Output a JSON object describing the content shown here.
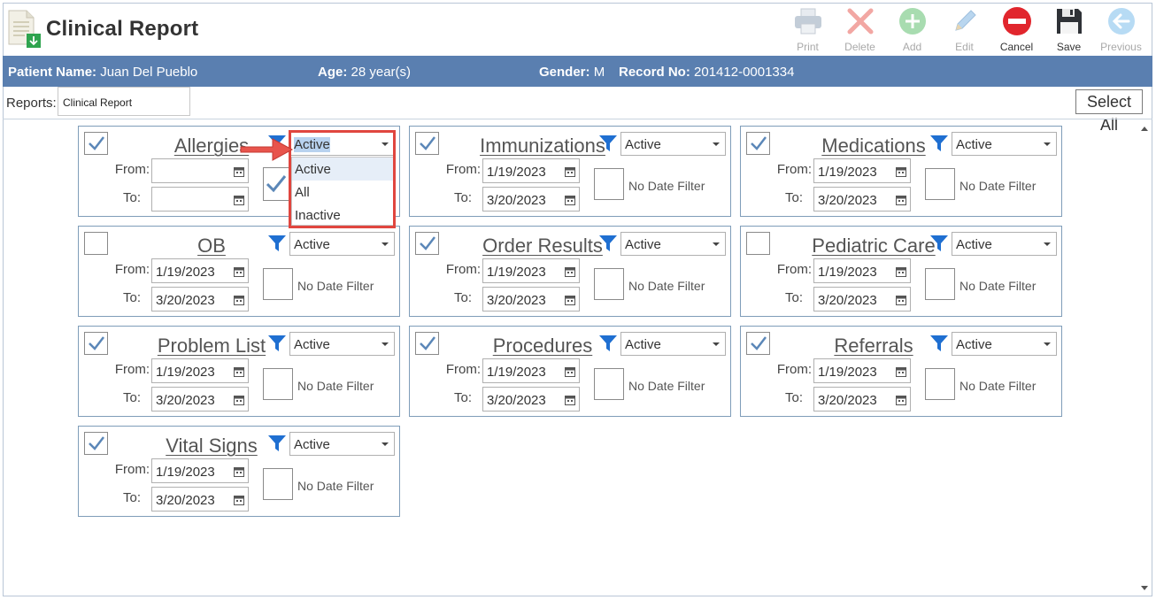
{
  "window": {
    "title": "Clinical Report"
  },
  "toolbar": {
    "print": "Print",
    "delete": "Delete",
    "add": "Add",
    "edit": "Edit",
    "cancel": "Cancel",
    "save": "Save",
    "previous": "Previous"
  },
  "patient": {
    "name_label": "Patient Name:",
    "name": "Juan Del Pueblo",
    "age_label": "Age:",
    "age": "28 year(s)",
    "gender_label": "Gender:",
    "gender": "M",
    "record_label": "Record No:",
    "record": "201412-0001334"
  },
  "reports": {
    "label": "Reports:",
    "value": "Clinical Report",
    "select_all": "Select All"
  },
  "labels": {
    "from": "From:",
    "to": "To:",
    "no_date_filter": "No Date Filter"
  },
  "cards": [
    {
      "name": "Allergies",
      "checked": true,
      "status": "Active",
      "from": "",
      "to": ""
    },
    {
      "name": "Immunizations",
      "checked": true,
      "status": "Active",
      "from": "1/19/2023",
      "to": "3/20/2023"
    },
    {
      "name": "Medications",
      "checked": true,
      "status": "Active",
      "from": "1/19/2023",
      "to": "3/20/2023"
    },
    {
      "name": "OB",
      "checked": false,
      "status": "Active",
      "from": "1/19/2023",
      "to": "3/20/2023"
    },
    {
      "name": "Order Results",
      "checked": true,
      "status": "Active",
      "from": "1/19/2023",
      "to": "3/20/2023"
    },
    {
      "name": "Pediatric Care",
      "checked": false,
      "status": "Active",
      "from": "1/19/2023",
      "to": "3/20/2023"
    },
    {
      "name": "Problem List",
      "checked": true,
      "status": "Active",
      "from": "1/19/2023",
      "to": "3/20/2023"
    },
    {
      "name": "Procedures",
      "checked": true,
      "status": "Active",
      "from": "1/19/2023",
      "to": "3/20/2023"
    },
    {
      "name": "Referrals",
      "checked": true,
      "status": "Active",
      "from": "1/19/2023",
      "to": "3/20/2023"
    },
    {
      "name": "Vital Signs",
      "checked": true,
      "status": "Active",
      "from": "1/19/2023",
      "to": "3/20/2023"
    }
  ],
  "dropdown": {
    "options": [
      "Active",
      "All",
      "Inactive"
    ]
  },
  "colors": {
    "patient_bar": "#5a7fb0",
    "filter_icon": "#1f6fd1",
    "check": "#5b87b8",
    "highlight": "#e0463f"
  }
}
